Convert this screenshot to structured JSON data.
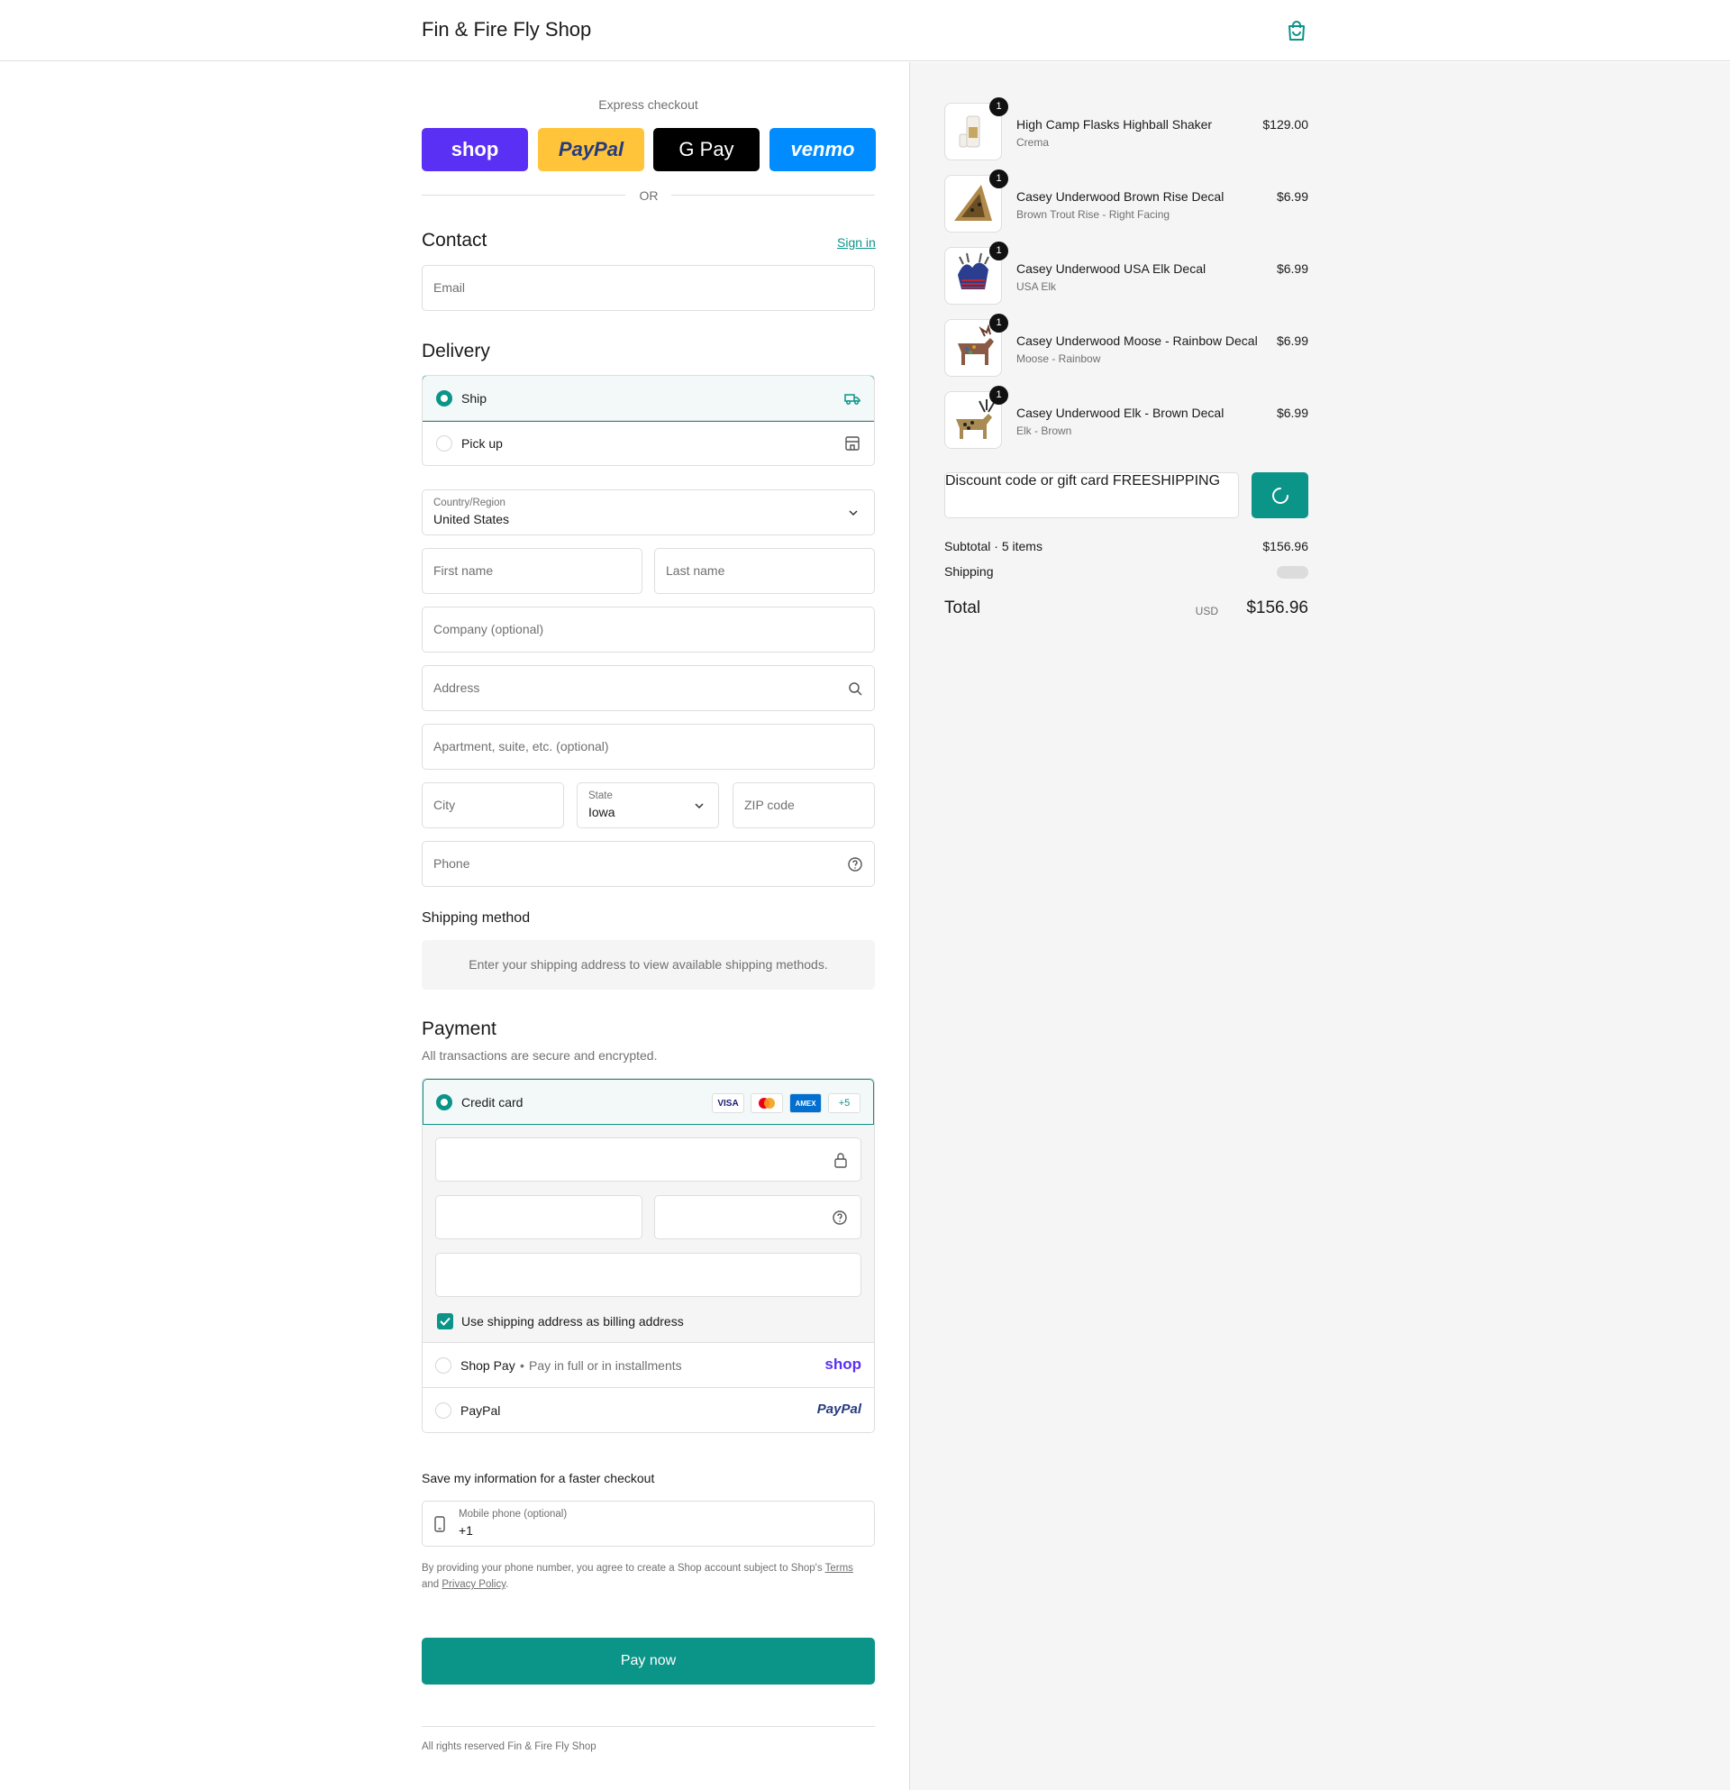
{
  "header": {
    "shop_name": "Fin & Fire Fly Shop"
  },
  "express": {
    "title": "Express checkout",
    "buttons": [
      {
        "label": "shop",
        "bg": "#5a31f4",
        "color": "#ffffff"
      },
      {
        "label": "PayPal",
        "bg": "#ffc439",
        "color": "#253b80"
      },
      {
        "label": "G Pay",
        "bg": "#000000",
        "color": "#ffffff"
      },
      {
        "label": "venmo",
        "bg": "#008cff",
        "color": "#ffffff"
      }
    ],
    "or": "OR"
  },
  "contact": {
    "title": "Contact",
    "sign_in": "Sign in",
    "email_placeholder": "Email"
  },
  "delivery": {
    "title": "Delivery",
    "options": [
      {
        "label": "Ship"
      },
      {
        "label": "Pick up"
      }
    ],
    "country_label": "Country/Region",
    "country_value": "United States",
    "first_name": "First name",
    "last_name": "Last name",
    "company": "Company (optional)",
    "address": "Address",
    "apartment": "Apartment, suite, etc. (optional)",
    "city": "City",
    "state_label": "State",
    "state_value": "Iowa",
    "zip": "ZIP code",
    "phone": "Phone"
  },
  "shipping_method": {
    "title": "Shipping method",
    "note": "Enter your shipping address to view available shipping methods."
  },
  "payment": {
    "title": "Payment",
    "subtitle": "All transactions are secure and encrypted.",
    "credit_card": "Credit card",
    "card_logos": [
      "VISA",
      "MC",
      "AMEX",
      "+5"
    ],
    "billing_checkbox": "Use shipping address as billing address",
    "shop_pay": "Shop Pay",
    "shop_pay_sub": "Pay in full or in installments",
    "shop_logo": "shop",
    "paypal": "PayPal",
    "paypal_logo": "PayPal"
  },
  "save_info": {
    "title": "Save my information for a faster checkout",
    "mobile_label": "Mobile phone (optional)",
    "mobile_value": "+1",
    "legal_1": "By providing your phone number, you agree to create a Shop account subject to Shop's",
    "terms": "Terms",
    "legal_and": "and",
    "privacy": "Privacy Policy",
    "legal_end": "."
  },
  "pay_now": "Pay now",
  "footer": "All rights reserved Fin & Fire Fly Shop",
  "order": {
    "items": [
      {
        "name": "High Camp Flasks Highball Shaker",
        "variant": "Crema",
        "price": "$129.00",
        "qty": "1"
      },
      {
        "name": "Casey Underwood Brown Rise Decal",
        "variant": "Brown Trout Rise - Right Facing",
        "price": "$6.99",
        "qty": "1"
      },
      {
        "name": "Casey Underwood USA Elk Decal",
        "variant": "USA Elk",
        "price": "$6.99",
        "qty": "1"
      },
      {
        "name": "Casey Underwood Moose - Rainbow Decal",
        "variant": "Moose - Rainbow",
        "price": "$6.99",
        "qty": "1"
      },
      {
        "name": "Casey Underwood Elk - Brown Decal",
        "variant": "Elk - Brown",
        "price": "$6.99",
        "qty": "1"
      }
    ],
    "discount_label": "Discount code or gift card",
    "discount_value": "FREESHIPPING",
    "subtotal_label": "Subtotal · 5 items",
    "subtotal_value": "$156.96",
    "shipping_label": "Shipping",
    "total_label": "Total",
    "currency": "USD",
    "total_value": "$156.96"
  },
  "colors": {
    "accent": "#0b9488",
    "border": "#dedede",
    "muted": "#707070"
  }
}
